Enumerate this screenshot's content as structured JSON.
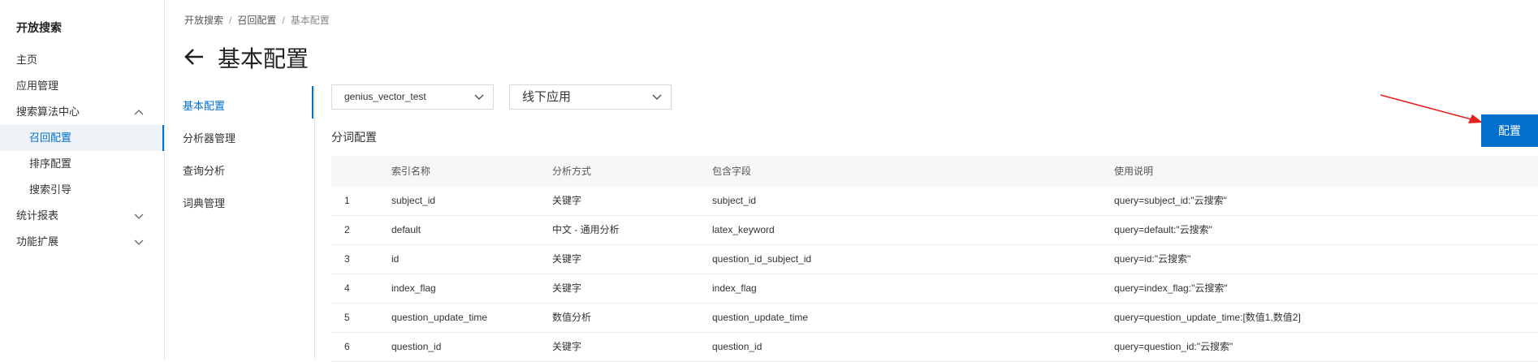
{
  "nav": {
    "title": "开放搜索",
    "items": [
      {
        "label": "主页"
      },
      {
        "label": "应用管理"
      },
      {
        "label": "搜索算法中心"
      },
      {
        "label": "召回配置"
      },
      {
        "label": "排序配置"
      },
      {
        "label": "搜索引导"
      },
      {
        "label": "统计报表"
      },
      {
        "label": "功能扩展"
      }
    ]
  },
  "breadcrumb": [
    "开放搜索",
    "召回配置",
    "基本配置"
  ],
  "page": {
    "title": "基本配置"
  },
  "submenu": {
    "items": [
      {
        "label": "基本配置"
      },
      {
        "label": "分析器管理"
      },
      {
        "label": "查询分析"
      },
      {
        "label": "词典管理"
      }
    ]
  },
  "selects": {
    "app": "genius_vector_test",
    "env": "线下应用"
  },
  "section": {
    "title": "分词配置"
  },
  "config_button": "配置",
  "table": {
    "headers": [
      "",
      "索引名称",
      "分析方式",
      "包含字段",
      "使用说明"
    ],
    "rows": [
      [
        "1",
        "subject_id",
        "关键字",
        "subject_id",
        "query=subject_id:\"云搜索\""
      ],
      [
        "2",
        "default",
        "中文 - 通用分析",
        "latex_keyword",
        "query=default:\"云搜索\""
      ],
      [
        "3",
        "id",
        "关键字",
        "question_id_subject_id",
        "query=id:\"云搜索\""
      ],
      [
        "4",
        "index_flag",
        "关键字",
        "index_flag",
        "query=index_flag:\"云搜索\""
      ],
      [
        "5",
        "question_update_time",
        "数值分析",
        "question_update_time",
        "query=question_update_time:[数值1,数值2]"
      ],
      [
        "6",
        "question_id",
        "关键字",
        "question_id",
        "query=question_id:\"云搜索\""
      ]
    ]
  },
  "colors": {
    "accent": "#0070cc",
    "annotation_arrow": "#e8201f"
  }
}
